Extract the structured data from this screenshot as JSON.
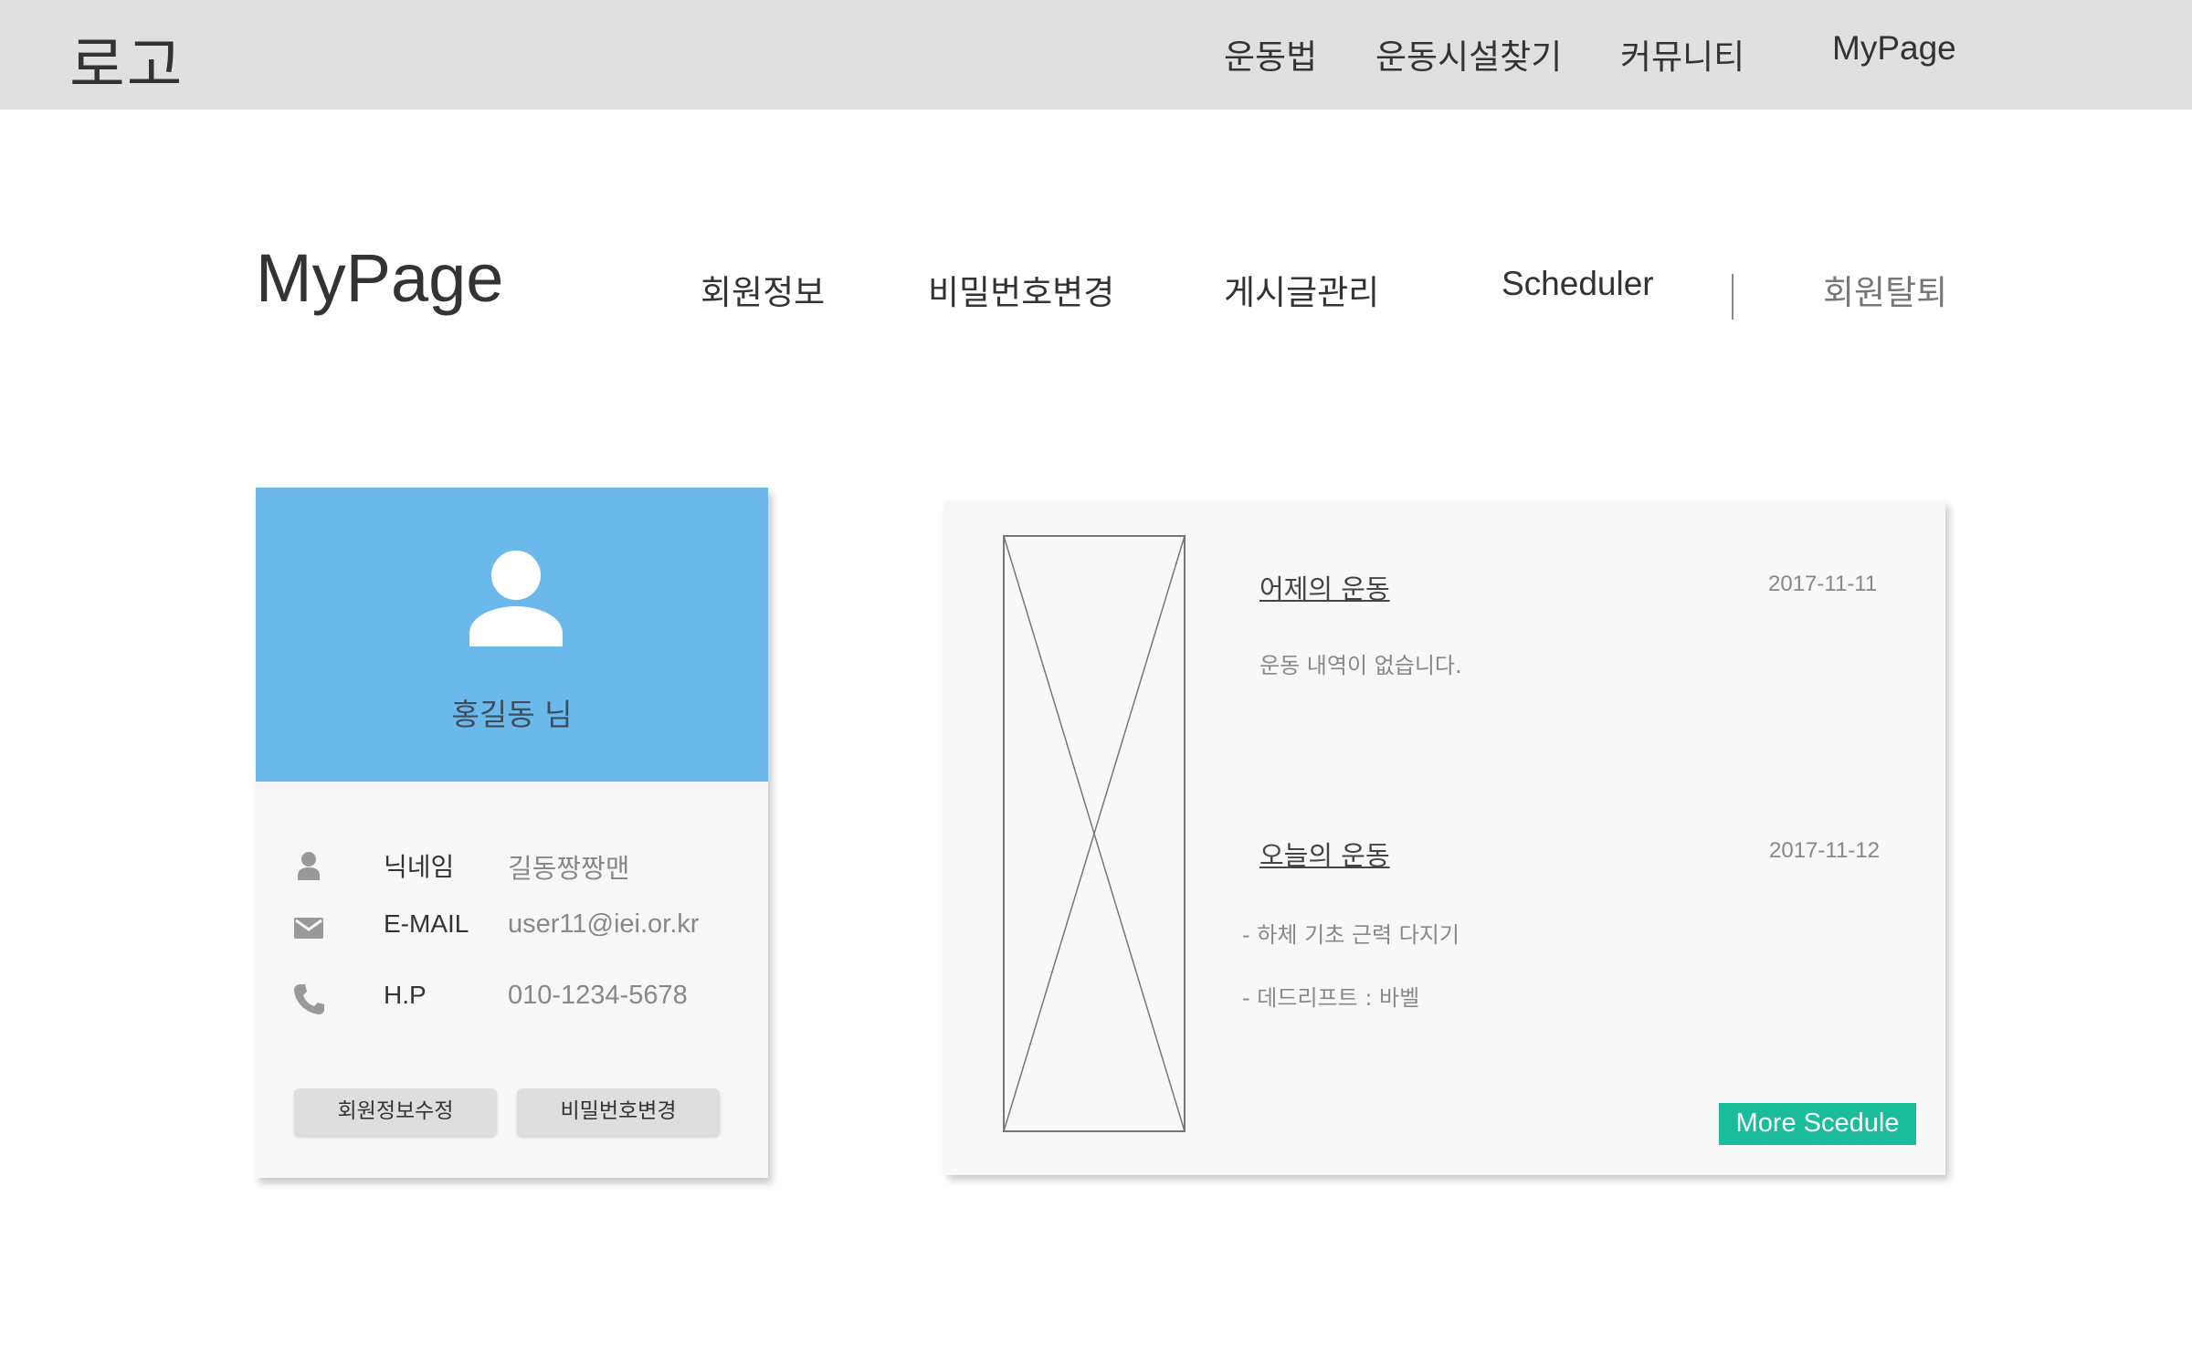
{
  "header": {
    "logo": "로고",
    "nav": [
      "운동법",
      "운동시설찾기",
      "커뮤니티",
      "MyPage"
    ]
  },
  "mypage": {
    "title": "MyPage",
    "tabs": [
      "회원정보",
      "비밀번호변경",
      "게시글관리",
      "Scheduler"
    ],
    "withdraw": "회원탈퇴"
  },
  "profile": {
    "name": "홍길동 님",
    "nickname_label": "닉네임",
    "nickname_value": "길동짱짱맨",
    "email_label": "E-MAIL",
    "email_value": "user11@iei.or.kr",
    "phone_label": "H.P",
    "phone_value": "010-1234-5678",
    "edit_button": "회원정보수정",
    "password_button": "비밀번호변경"
  },
  "schedule": {
    "yesterday_title": "어제의 운동",
    "yesterday_date": "2017-11-11",
    "yesterday_text": "운동 내역이 없습니다.",
    "today_title": "오늘의 운동",
    "today_date": "2017-11-12",
    "today_items": [
      "- 하체 기초 근력 다지기",
      "- 데드리프트 : 바벨"
    ],
    "more_button": "More Scedule"
  },
  "colors": {
    "header_bg": "#e0e0e0",
    "profile_header": "#6bb8ea",
    "accent_button": "#1bbc9b"
  },
  "icons": [
    "person-icon",
    "mail-icon",
    "phone-icon",
    "image-placeholder-icon"
  ]
}
